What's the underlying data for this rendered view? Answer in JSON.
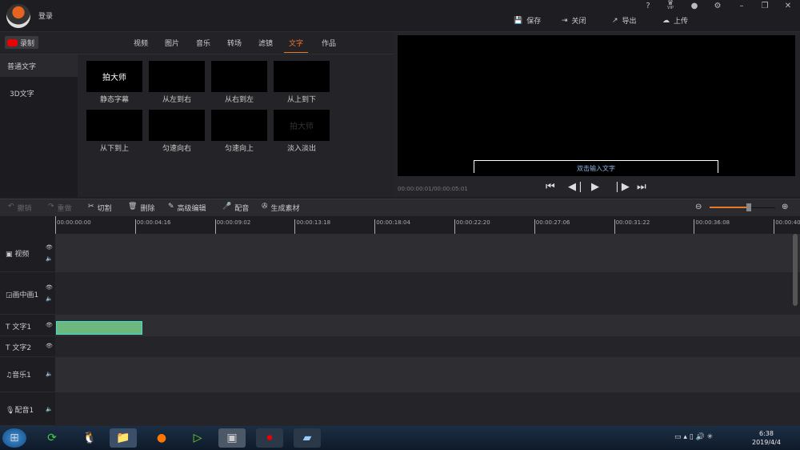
{
  "titlebar": {
    "login": "登录",
    "help": "?",
    "vip": "VIP",
    "actions": {
      "save": "保存",
      "close": "关闭",
      "export": "导出",
      "upload": "上传"
    }
  },
  "record_label": "录制",
  "tabs": [
    "视频",
    "图片",
    "音乐",
    "转场",
    "滤镜",
    "文字",
    "作品"
  ],
  "active_tab": "文字",
  "categories": [
    "普通文字",
    "3D文字"
  ],
  "templates": [
    {
      "label": "静态字幕",
      "preview": "拍大师"
    },
    {
      "label": "从左到右",
      "preview": ""
    },
    {
      "label": "从右到左",
      "preview": ""
    },
    {
      "label": "从上到下",
      "preview": ""
    },
    {
      "label": "从下到上",
      "preview": ""
    },
    {
      "label": "匀速向右",
      "preview": ""
    },
    {
      "label": "匀速向上",
      "preview": ""
    },
    {
      "label": "淡入淡出",
      "preview": "拍大师"
    }
  ],
  "preview": {
    "caption": "双击输入文字",
    "timecode": "00:00:00:01/00:00:05:01"
  },
  "toolbar": {
    "undo": "撤销",
    "redo": "重做",
    "cut": "切割",
    "delete": "删除",
    "advanced": "高级编辑",
    "dub": "配音",
    "generate": "生成素材",
    "zoom_level": 0.6
  },
  "ruler": [
    "00:00:00:00",
    "00:00:04:16",
    "00:00:09:02",
    "00:00:13:18",
    "00:00:18:04",
    "00:00:22:20",
    "00:00:27:06",
    "00:00:31:22",
    "00:00:36:08",
    "00:00:40:"
  ],
  "tracks": [
    {
      "name": "视频"
    },
    {
      "name": "画中画1"
    },
    {
      "name": "文字1"
    },
    {
      "name": "文字2"
    },
    {
      "name": "音乐1"
    },
    {
      "name": "配音1"
    }
  ],
  "taskbar": {
    "time": "6:38",
    "date": "2019/4/4"
  },
  "colors": {
    "accent": "#e8782a",
    "clip": "#6db87e",
    "record": "#e00000"
  }
}
